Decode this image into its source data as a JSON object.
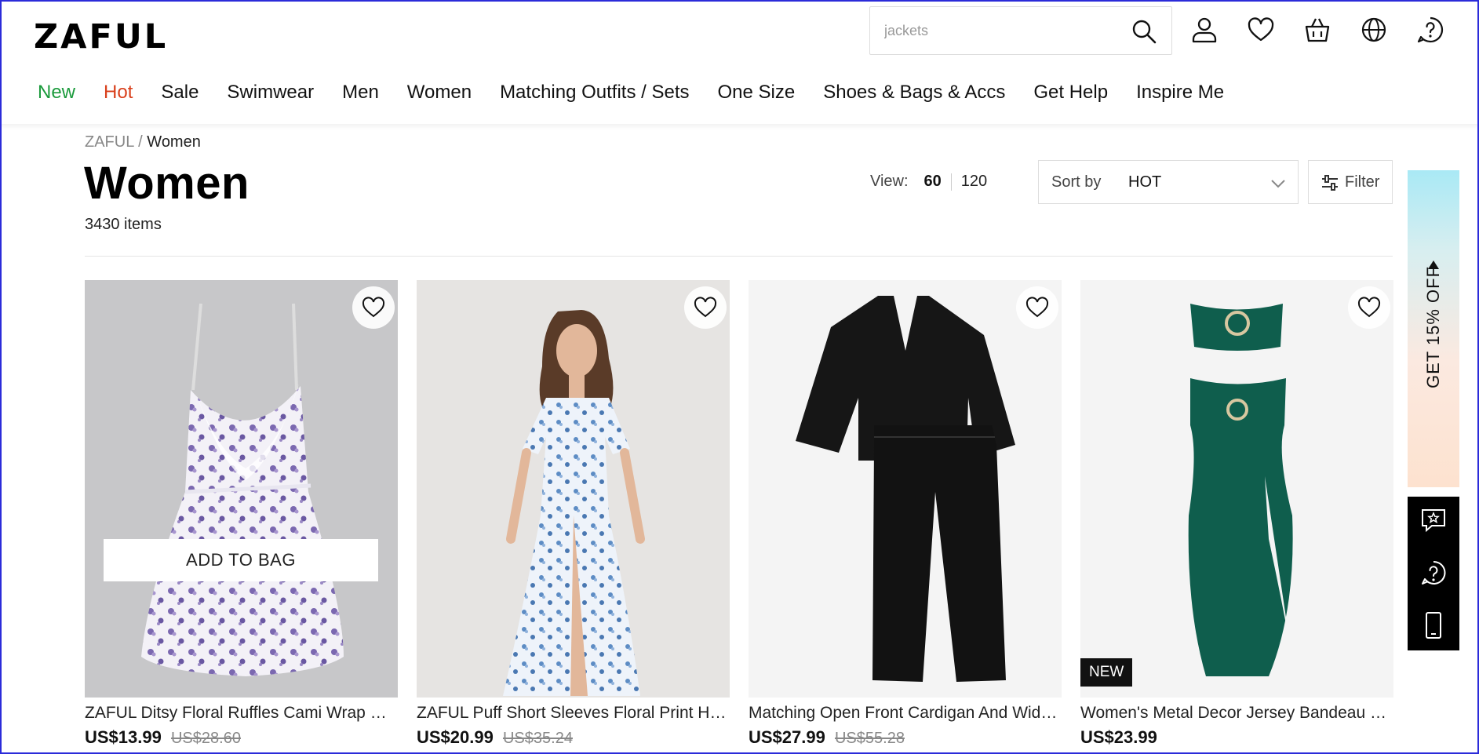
{
  "header": {
    "logo": "ZAFUL",
    "search_placeholder": "jackets",
    "nav": [
      {
        "label": "New",
        "color": "#1a9a3b"
      },
      {
        "label": "Hot",
        "color": "#d9401c"
      },
      {
        "label": "Sale",
        "color": "#111111"
      },
      {
        "label": "Swimwear",
        "color": "#111111"
      },
      {
        "label": "Men",
        "color": "#111111"
      },
      {
        "label": "Women",
        "color": "#111111"
      },
      {
        "label": "Matching Outfits / Sets",
        "color": "#111111"
      },
      {
        "label": "One Size",
        "color": "#111111"
      },
      {
        "label": "Shoes & Bags & Accs",
        "color": "#111111"
      },
      {
        "label": "Get Help",
        "color": "#111111"
      },
      {
        "label": "Inspire Me",
        "color": "#111111"
      }
    ],
    "icons": [
      "search-icon",
      "user-icon",
      "heart-icon",
      "bag-icon",
      "globe-icon",
      "help-icon"
    ]
  },
  "breadcrumb": {
    "root": "ZAFUL",
    "sep": "/",
    "current": "Women"
  },
  "page": {
    "title": "Women",
    "count": "3430 items"
  },
  "view": {
    "label": "View:",
    "options": [
      "60",
      "120"
    ],
    "active": "60"
  },
  "sort": {
    "label": "Sort by",
    "value": "HOT"
  },
  "filter": {
    "label": "Filter"
  },
  "products": [
    {
      "name": "ZAFUL Ditsy Floral Ruffles Cami Wrap Mini...",
      "price": "US$13.99",
      "original": "US$28.60",
      "add_to_bag": "ADD TO BAG"
    },
    {
      "name": "ZAFUL Puff Short Sleeves Floral Print High...",
      "price": "US$20.99",
      "original": "US$35.24"
    },
    {
      "name": "Matching Open Front Cardigan And Wide...",
      "price": "US$27.99",
      "original": "US$55.28"
    },
    {
      "name": "Women's Metal Decor Jersey Bandeau Cr...",
      "price": "US$23.99",
      "original": "",
      "badge": "NEW"
    }
  ],
  "promo": {
    "text": "GET 15% OFF"
  },
  "rail_icons": [
    "review-star-icon",
    "help-icon",
    "mobile-icon"
  ],
  "colors": {
    "new": "#1a9a3b",
    "hot": "#d9401c",
    "green_product": "#0f5e4d"
  }
}
